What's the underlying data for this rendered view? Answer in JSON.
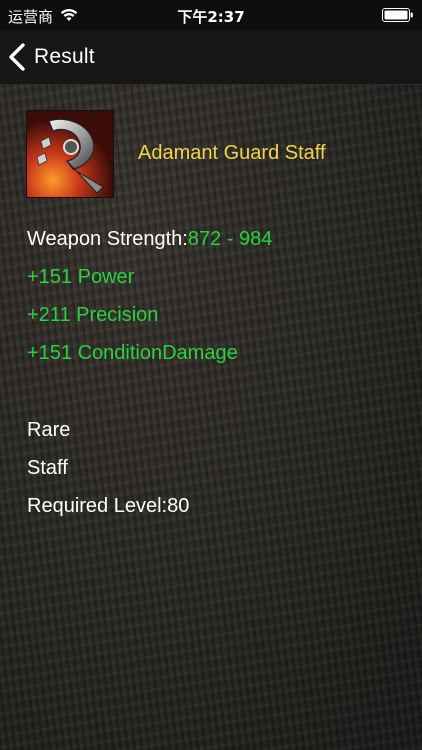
{
  "status_bar": {
    "carrier": "运营商",
    "time": "下午2:37",
    "wifi_icon": "wifi-icon",
    "battery_icon": "battery-icon"
  },
  "nav": {
    "back_label": "Result",
    "back_icon": "chevron-left-icon"
  },
  "item": {
    "icon": "weapon-staff-icon",
    "name": "Adamant Guard Staff",
    "name_color": "#f1d44a",
    "weapon_strength_label": "Weapon Strength:",
    "weapon_strength_value": "872 - 984",
    "attributes": [
      "+151 Power",
      "+211 Precision",
      "+151 ConditionDamage"
    ],
    "rarity": "Rare",
    "type": "Staff",
    "required_level": "Required Level:80"
  },
  "colors": {
    "stat_green": "#2bd13f",
    "background": "#2a2824"
  }
}
